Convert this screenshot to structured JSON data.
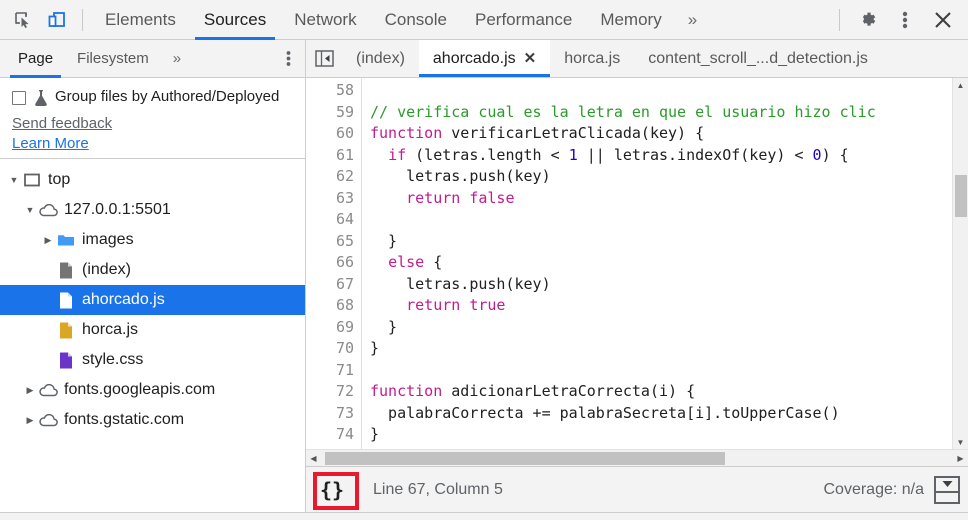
{
  "toolbar": {
    "inspect_icon": "inspect-cursor-icon",
    "device_icon": "device-toggle-icon",
    "tabs": [
      {
        "label": "Elements",
        "active": false
      },
      {
        "label": "Sources",
        "active": true
      },
      {
        "label": "Network",
        "active": false
      },
      {
        "label": "Console",
        "active": false
      },
      {
        "label": "Performance",
        "active": false
      },
      {
        "label": "Memory",
        "active": false
      }
    ],
    "more_label": "»",
    "settings_icon": "gear-icon",
    "menu_icon": "kebab-menu-icon",
    "close_icon": "close-icon",
    "accent": "#1a73e8"
  },
  "sidebar": {
    "tabs": [
      {
        "label": "Page",
        "active": true
      },
      {
        "label": "Filesystem",
        "active": false
      }
    ],
    "more_label": "»",
    "dots_icon": "kebab-menu-icon",
    "group": {
      "checkbox_checked": false,
      "flask_icon": "experiment-flask-icon",
      "label": "Group files by Authored/Deployed",
      "feedback_link": "Send feedback",
      "learn_link": "Learn More"
    },
    "tree": [
      {
        "label": "top",
        "indent": 0,
        "twisty": "down",
        "icon": "frame-icon",
        "selected": false
      },
      {
        "label": "127.0.0.1:5501",
        "indent": 1,
        "twisty": "down",
        "icon": "cloud-icon",
        "selected": false
      },
      {
        "label": "images",
        "indent": 2,
        "twisty": "right",
        "icon": "folder-icon",
        "selected": false
      },
      {
        "label": "(index)",
        "indent": 2,
        "twisty": "none",
        "icon": "document-gray-icon",
        "selected": false
      },
      {
        "label": "ahorcado.js",
        "indent": 2,
        "twisty": "none",
        "icon": "document-white-icon",
        "selected": true
      },
      {
        "label": "horca.js",
        "indent": 2,
        "twisty": "none",
        "icon": "document-yellow-icon",
        "selected": false
      },
      {
        "label": "style.css",
        "indent": 2,
        "twisty": "none",
        "icon": "document-purple-icon",
        "selected": false
      },
      {
        "label": "fonts.googleapis.com",
        "indent": 1,
        "twisty": "right",
        "icon": "cloud-icon",
        "selected": false
      },
      {
        "label": "fonts.gstatic.com",
        "indent": 1,
        "twisty": "right",
        "icon": "cloud-icon",
        "selected": false
      }
    ]
  },
  "editor": {
    "nav_icon": "show-navigator-icon",
    "tabs": [
      {
        "label": "(index)",
        "active": false,
        "closable": false
      },
      {
        "label": "ahorcado.js",
        "active": true,
        "closable": true
      },
      {
        "label": "horca.js",
        "active": false,
        "closable": false
      },
      {
        "label": "content_scroll_...d_detection.js",
        "active": false,
        "closable": false
      }
    ],
    "close_glyph": "✕",
    "first_line_number": 58,
    "lines": [
      {
        "n": 58,
        "tokens": []
      },
      {
        "n": 59,
        "tokens": [
          {
            "t": "// verifica cual es la letra en que el usuario hizo clic",
            "c": "com"
          }
        ]
      },
      {
        "n": 60,
        "tokens": [
          {
            "t": "function",
            "c": "kw"
          },
          {
            "t": " verificarLetraClicada(key) {",
            "c": "pl"
          }
        ]
      },
      {
        "n": 61,
        "tokens": [
          {
            "t": "  ",
            "c": "pl"
          },
          {
            "t": "if",
            "c": "kw"
          },
          {
            "t": " (letras.length < ",
            "c": "pl"
          },
          {
            "t": "1",
            "c": "num"
          },
          {
            "t": " || letras.indexOf(key) < ",
            "c": "pl"
          },
          {
            "t": "0",
            "c": "num"
          },
          {
            "t": ") {",
            "c": "pl"
          }
        ]
      },
      {
        "n": 62,
        "tokens": [
          {
            "t": "    letras.push(key)",
            "c": "pl"
          }
        ]
      },
      {
        "n": 63,
        "tokens": [
          {
            "t": "    ",
            "c": "pl"
          },
          {
            "t": "return",
            "c": "kw"
          },
          {
            "t": " ",
            "c": "pl"
          },
          {
            "t": "false",
            "c": "kw"
          }
        ]
      },
      {
        "n": 64,
        "tokens": []
      },
      {
        "n": 65,
        "tokens": [
          {
            "t": "  }",
            "c": "pl"
          }
        ]
      },
      {
        "n": 66,
        "tokens": [
          {
            "t": "  ",
            "c": "pl"
          },
          {
            "t": "else",
            "c": "kw"
          },
          {
            "t": " {",
            "c": "pl"
          }
        ]
      },
      {
        "n": 67,
        "tokens": [
          {
            "t": "    letras.push(key)",
            "c": "pl"
          }
        ]
      },
      {
        "n": 68,
        "tokens": [
          {
            "t": "    ",
            "c": "pl"
          },
          {
            "t": "return",
            "c": "kw"
          },
          {
            "t": " ",
            "c": "pl"
          },
          {
            "t": "true",
            "c": "kw"
          }
        ]
      },
      {
        "n": 69,
        "tokens": [
          {
            "t": "  }",
            "c": "pl"
          }
        ]
      },
      {
        "n": 70,
        "tokens": [
          {
            "t": "}",
            "c": "pl"
          }
        ]
      },
      {
        "n": 71,
        "tokens": []
      },
      {
        "n": 72,
        "tokens": [
          {
            "t": "function",
            "c": "kw"
          },
          {
            "t": " adicionarLetraCorrecta(i) {",
            "c": "pl"
          }
        ]
      },
      {
        "n": 73,
        "tokens": [
          {
            "t": "  palabraCorrecta += palabraSecreta[i].toUpperCase()",
            "c": "pl"
          }
        ]
      },
      {
        "n": 74,
        "tokens": [
          {
            "t": "}",
            "c": "pl"
          }
        ]
      }
    ],
    "syntax_colors": {
      "comment": "#2a9b2a",
      "keyword": "#c41a8c",
      "number": "#1c00cf",
      "plain": "#202020"
    }
  },
  "statusbar": {
    "pretty_print_label": "{}",
    "pretty_print_highlight": "#e8192c",
    "cursor_position": "Line 67, Column 5",
    "coverage": "Coverage: n/a",
    "drawer_icon": "show-drawer-icon"
  }
}
